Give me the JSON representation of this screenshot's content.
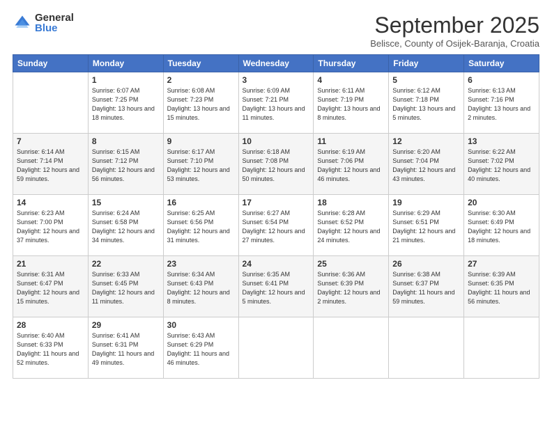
{
  "logo": {
    "general": "General",
    "blue": "Blue"
  },
  "title": "September 2025",
  "subtitle": "Belisce, County of Osijek-Baranja, Croatia",
  "days_of_week": [
    "Sunday",
    "Monday",
    "Tuesday",
    "Wednesday",
    "Thursday",
    "Friday",
    "Saturday"
  ],
  "weeks": [
    [
      {
        "day": "",
        "sunrise": "",
        "sunset": "",
        "daylight": ""
      },
      {
        "day": "1",
        "sunrise": "6:07 AM",
        "sunset": "7:25 PM",
        "daylight": "13 hours and 18 minutes."
      },
      {
        "day": "2",
        "sunrise": "6:08 AM",
        "sunset": "7:23 PM",
        "daylight": "13 hours and 15 minutes."
      },
      {
        "day": "3",
        "sunrise": "6:09 AM",
        "sunset": "7:21 PM",
        "daylight": "13 hours and 11 minutes."
      },
      {
        "day": "4",
        "sunrise": "6:11 AM",
        "sunset": "7:19 PM",
        "daylight": "13 hours and 8 minutes."
      },
      {
        "day": "5",
        "sunrise": "6:12 AM",
        "sunset": "7:18 PM",
        "daylight": "13 hours and 5 minutes."
      },
      {
        "day": "6",
        "sunrise": "6:13 AM",
        "sunset": "7:16 PM",
        "daylight": "13 hours and 2 minutes."
      }
    ],
    [
      {
        "day": "7",
        "sunrise": "6:14 AM",
        "sunset": "7:14 PM",
        "daylight": "12 hours and 59 minutes."
      },
      {
        "day": "8",
        "sunrise": "6:15 AM",
        "sunset": "7:12 PM",
        "daylight": "12 hours and 56 minutes."
      },
      {
        "day": "9",
        "sunrise": "6:17 AM",
        "sunset": "7:10 PM",
        "daylight": "12 hours and 53 minutes."
      },
      {
        "day": "10",
        "sunrise": "6:18 AM",
        "sunset": "7:08 PM",
        "daylight": "12 hours and 50 minutes."
      },
      {
        "day": "11",
        "sunrise": "6:19 AM",
        "sunset": "7:06 PM",
        "daylight": "12 hours and 46 minutes."
      },
      {
        "day": "12",
        "sunrise": "6:20 AM",
        "sunset": "7:04 PM",
        "daylight": "12 hours and 43 minutes."
      },
      {
        "day": "13",
        "sunrise": "6:22 AM",
        "sunset": "7:02 PM",
        "daylight": "12 hours and 40 minutes."
      }
    ],
    [
      {
        "day": "14",
        "sunrise": "6:23 AM",
        "sunset": "7:00 PM",
        "daylight": "12 hours and 37 minutes."
      },
      {
        "day": "15",
        "sunrise": "6:24 AM",
        "sunset": "6:58 PM",
        "daylight": "12 hours and 34 minutes."
      },
      {
        "day": "16",
        "sunrise": "6:25 AM",
        "sunset": "6:56 PM",
        "daylight": "12 hours and 31 minutes."
      },
      {
        "day": "17",
        "sunrise": "6:27 AM",
        "sunset": "6:54 PM",
        "daylight": "12 hours and 27 minutes."
      },
      {
        "day": "18",
        "sunrise": "6:28 AM",
        "sunset": "6:52 PM",
        "daylight": "12 hours and 24 minutes."
      },
      {
        "day": "19",
        "sunrise": "6:29 AM",
        "sunset": "6:51 PM",
        "daylight": "12 hours and 21 minutes."
      },
      {
        "day": "20",
        "sunrise": "6:30 AM",
        "sunset": "6:49 PM",
        "daylight": "12 hours and 18 minutes."
      }
    ],
    [
      {
        "day": "21",
        "sunrise": "6:31 AM",
        "sunset": "6:47 PM",
        "daylight": "12 hours and 15 minutes."
      },
      {
        "day": "22",
        "sunrise": "6:33 AM",
        "sunset": "6:45 PM",
        "daylight": "12 hours and 11 minutes."
      },
      {
        "day": "23",
        "sunrise": "6:34 AM",
        "sunset": "6:43 PM",
        "daylight": "12 hours and 8 minutes."
      },
      {
        "day": "24",
        "sunrise": "6:35 AM",
        "sunset": "6:41 PM",
        "daylight": "12 hours and 5 minutes."
      },
      {
        "day": "25",
        "sunrise": "6:36 AM",
        "sunset": "6:39 PM",
        "daylight": "12 hours and 2 minutes."
      },
      {
        "day": "26",
        "sunrise": "6:38 AM",
        "sunset": "6:37 PM",
        "daylight": "11 hours and 59 minutes."
      },
      {
        "day": "27",
        "sunrise": "6:39 AM",
        "sunset": "6:35 PM",
        "daylight": "11 hours and 56 minutes."
      }
    ],
    [
      {
        "day": "28",
        "sunrise": "6:40 AM",
        "sunset": "6:33 PM",
        "daylight": "11 hours and 52 minutes."
      },
      {
        "day": "29",
        "sunrise": "6:41 AM",
        "sunset": "6:31 PM",
        "daylight": "11 hours and 49 minutes."
      },
      {
        "day": "30",
        "sunrise": "6:43 AM",
        "sunset": "6:29 PM",
        "daylight": "11 hours and 46 minutes."
      },
      {
        "day": "",
        "sunrise": "",
        "sunset": "",
        "daylight": ""
      },
      {
        "day": "",
        "sunrise": "",
        "sunset": "",
        "daylight": ""
      },
      {
        "day": "",
        "sunrise": "",
        "sunset": "",
        "daylight": ""
      },
      {
        "day": "",
        "sunrise": "",
        "sunset": "",
        "daylight": ""
      }
    ]
  ],
  "labels": {
    "sunrise": "Sunrise:",
    "sunset": "Sunset:",
    "daylight": "Daylight:"
  }
}
